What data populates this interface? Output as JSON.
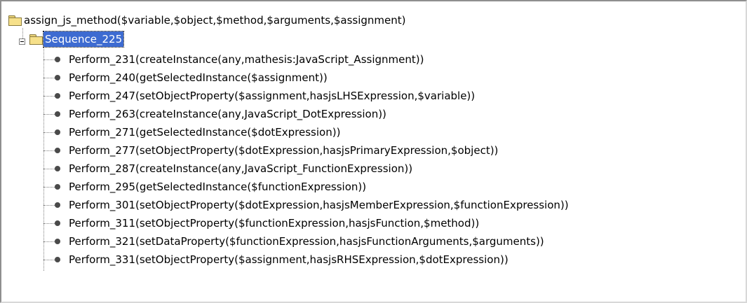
{
  "tree": {
    "root_label": "assign_js_method($variable,$object,$method,$arguments,$assignment)",
    "sequence_label": "Sequence_225",
    "steps": [
      "Perform_231(createInstance(any,mathesis:JavaScript_Assignment))",
      "Perform_240(getSelectedInstance($assignment))",
      "Perform_247(setObjectProperty($assignment,hasjsLHSExpression,$variable))",
      "Perform_263(createInstance(any,JavaScript_DotExpression))",
      "Perform_271(getSelectedInstance($dotExpression))",
      "Perform_277(setObjectProperty($dotExpression,hasjsPrimaryExpression,$object))",
      "Perform_287(createInstance(any,JavaScript_FunctionExpression))",
      "Perform_295(getSelectedInstance($functionExpression))",
      "Perform_301(setObjectProperty($dotExpression,hasjsMemberExpression,$functionExpression))",
      "Perform_311(setObjectProperty($functionExpression,hasjsFunction,$method))",
      "Perform_321(setDataProperty($functionExpression,hasjsFunctionArguments,$arguments))",
      "Perform_331(setObjectProperty($assignment,hasjsRHSExpression,$dotExpression))"
    ]
  },
  "colors": {
    "selection": "#3d6bd1",
    "folder": "#f6e08a"
  }
}
